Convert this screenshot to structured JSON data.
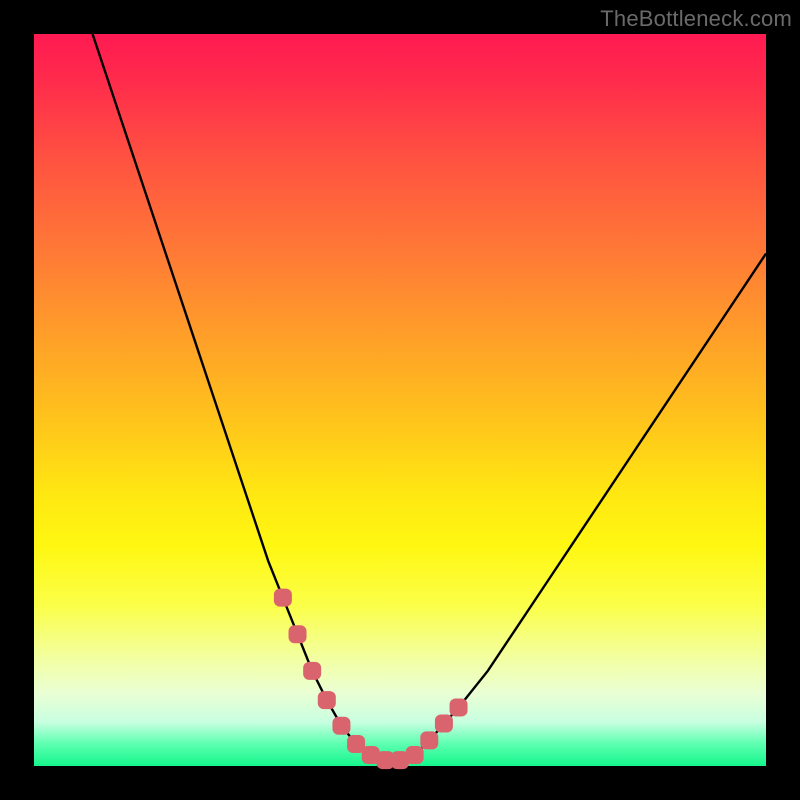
{
  "watermark": "TheBottleneck.com",
  "colors": {
    "frame": "#000000",
    "curve_stroke": "#000000",
    "marker_fill": "#d9646d",
    "marker_stroke": "#d9646d"
  },
  "chart_data": {
    "type": "line",
    "title": "",
    "xlabel": "",
    "ylabel": "",
    "xlim": [
      0,
      100
    ],
    "ylim": [
      0,
      100
    ],
    "grid": false,
    "legend": false,
    "x": [
      8,
      10,
      12,
      14,
      16,
      18,
      20,
      22,
      24,
      26,
      28,
      30,
      32,
      34,
      36,
      38,
      40,
      42,
      44,
      46,
      48,
      50,
      52,
      54,
      58,
      62,
      66,
      70,
      74,
      78,
      82,
      86,
      90,
      94,
      98,
      100
    ],
    "values": [
      100,
      94,
      88,
      82,
      76,
      70,
      64,
      58,
      52,
      46,
      40,
      34,
      28,
      23,
      18,
      13,
      9,
      5.5,
      3,
      1.5,
      0.8,
      0.8,
      1.5,
      3.5,
      8,
      13,
      19,
      25,
      31,
      37,
      43,
      49,
      55,
      61,
      67,
      70
    ],
    "markers": {
      "x": [
        34,
        36,
        38,
        40,
        42,
        44,
        46,
        48,
        50,
        52,
        54,
        56,
        58
      ],
      "y": [
        23,
        18,
        13,
        9,
        5.5,
        3,
        1.5,
        0.8,
        0.8,
        1.5,
        3.5,
        5.8,
        8
      ]
    },
    "annotations": []
  }
}
